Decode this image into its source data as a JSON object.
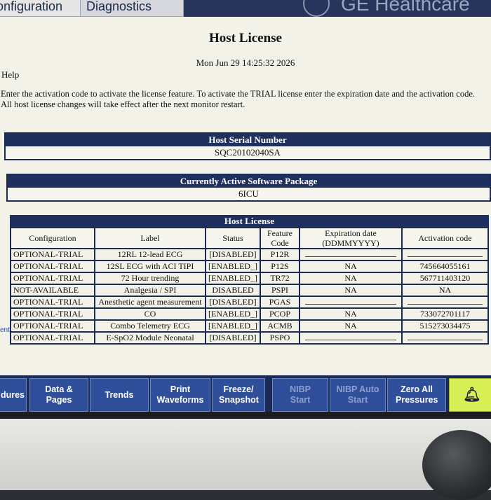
{
  "tabs": [
    "onfiguration",
    "Diagnostics"
  ],
  "brand": "GE Healthcare",
  "page_title": "Host License",
  "datetime": "Mon Jun 29 14:25:32 2026",
  "help_label": "Help",
  "instructions": [
    "Enter the activation code to activate the license feature. To activate the TRIAL license enter the expiration date and the activation code.",
    "All host license changes will take effect after the next monitor restart."
  ],
  "host_serial": {
    "title": "Host Serial Number",
    "value": "SQC20102040SA"
  },
  "active_package": {
    "title": "Currently Active Software Package",
    "value": "6ICU"
  },
  "license_table": {
    "title": "Host License",
    "headers": [
      "Configuration",
      "Label",
      "Status",
      "Feature Code",
      "Expiration date (DDMMYYYY)",
      "Activation code"
    ],
    "rows": [
      {
        "config": "OPTIONAL-TRIAL",
        "label": "12RL 12-lead ECG",
        "status": "[DISABLED]",
        "code": "P12R",
        "exp": "",
        "act": ""
      },
      {
        "config": "OPTIONAL-TRIAL",
        "label": "12SL ECG with ACI TIPI",
        "status": "[ENABLED_]",
        "code": "P12S",
        "exp": "NA",
        "act": "745664055161"
      },
      {
        "config": "OPTIONAL-TRIAL",
        "label": "72 Hour trending",
        "status": "[ENABLED_]",
        "code": "TR72",
        "exp": "NA",
        "act": "567711403120"
      },
      {
        "config": "NOT-AVAILABLE",
        "label": "Analgesia / SPI",
        "status": "DISABLED",
        "code": "PSPI",
        "exp": "NA",
        "act": "NA"
      },
      {
        "config": "OPTIONAL-TRIAL",
        "label": "Anesthetic agent measurement",
        "status": "[DISABLED]",
        "code": "PGAS",
        "exp": "",
        "act": ""
      },
      {
        "config": "OPTIONAL-TRIAL",
        "label": "CO",
        "status": "[ENABLED_]",
        "code": "PCOP",
        "exp": "NA",
        "act": "733072701117"
      },
      {
        "config": "OPTIONAL-TRIAL",
        "label": "Combo Telemetry ECG",
        "status": "[ENABLED_]",
        "code": "ACMB",
        "exp": "NA",
        "act": "515273034475"
      },
      {
        "config": "OPTIONAL-TRIAL",
        "label": "E-SpO2 Module Neonatal",
        "status": "[DISABLED]",
        "code": "PSPO",
        "exp": "",
        "act": ""
      }
    ]
  },
  "left_marks": [
    "ent"
  ],
  "toolbar": {
    "buttons": [
      "dures",
      "Data & Pages",
      "Trends",
      "Print Waveforms",
      "Freeze/ Snapshot",
      "NIBP Start",
      "NIBP Auto Start",
      "Zero All Pressures"
    ],
    "alarm_icon": "bell-alarm-icon"
  }
}
